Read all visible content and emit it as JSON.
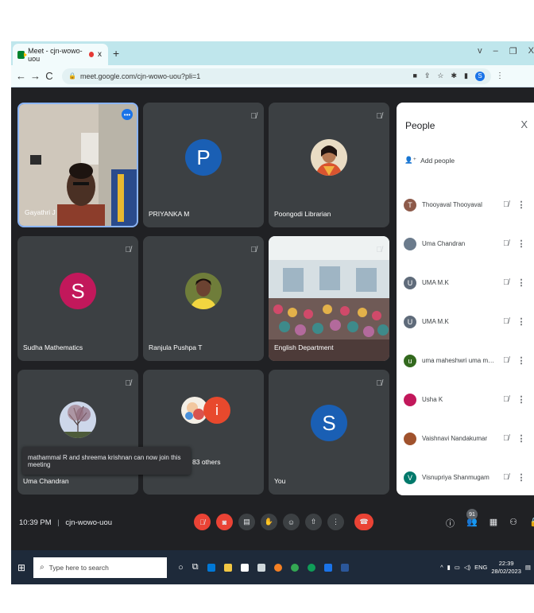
{
  "browser": {
    "tab_title": "Meet - cjn-wowo-uou",
    "tab_close": "x",
    "new_tab": "+",
    "url": "meet.google.com/cjn-wowo-uou?pli=1",
    "profile_letter": "S",
    "window_controls": [
      "v",
      "–",
      "❐",
      "X"
    ]
  },
  "tiles": [
    {
      "name": "Gayathri J",
      "kind": "video-teacher"
    },
    {
      "name": "PRIYANKA M",
      "kind": "letter",
      "letter": "P",
      "color": "#1a5fb4"
    },
    {
      "name": "Poongodi Librarian",
      "kind": "photo-woman"
    },
    {
      "name": "Sudha Mathematics",
      "kind": "letter",
      "letter": "S",
      "color": "#c2185b"
    },
    {
      "name": "Ranjula Pushpa T",
      "kind": "photo-girl"
    },
    {
      "name": "English Department",
      "kind": "video-classroom"
    },
    {
      "name": "Uma Chandran",
      "kind": "photo-tree"
    },
    {
      "name": "83 others",
      "kind": "group",
      "letter": "i",
      "color": "#e8492d"
    },
    {
      "name": "You",
      "kind": "letter",
      "letter": "S",
      "color": "#1a5fb4"
    }
  ],
  "toast": "mathammal R and shreema krishnan can now join this meeting",
  "people_panel": {
    "title": "People",
    "close": "X",
    "add_people": "Add people",
    "participants": [
      {
        "name": "Thooyaval Thooyaval",
        "initial": "T",
        "color": "#8d5a4a"
      },
      {
        "name": "Uma Chandran",
        "initial": "",
        "color": "#6b7b8c"
      },
      {
        "name": "UMA M.K",
        "initial": "U",
        "color": "#5f6b7a"
      },
      {
        "name": "UMA M.K",
        "initial": "U",
        "color": "#5f6b7a"
      },
      {
        "name": "uma maheshwri uma mah...",
        "initial": "u",
        "color": "#33691e"
      },
      {
        "name": "Usha K",
        "initial": "",
        "color": "#c2185b"
      },
      {
        "name": "Vaishnavi Nandakumar",
        "initial": "",
        "color": "#a0522d"
      },
      {
        "name": "Visnupriya Shanmugam",
        "initial": "V",
        "color": "#00796b"
      }
    ]
  },
  "bottom_bar": {
    "time": "10:39 PM",
    "meeting_code": "cjn-wowo-uou",
    "participant_count": "91"
  },
  "taskbar": {
    "search_placeholder": "Type here to search",
    "language": "ENG",
    "clock_time": "22:39",
    "clock_date": "28/02/2023"
  }
}
